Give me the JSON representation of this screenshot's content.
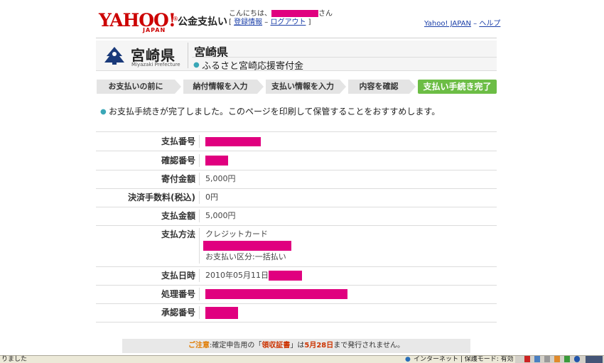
{
  "header": {
    "logo_text": "YAHOO!",
    "logo_sub": "JAPAN",
    "logo_mark": "®",
    "service_title": "公金支払い",
    "greeting_prefix": "こんにちは、",
    "greeting_suffix": "さん",
    "link_register": "登録情報",
    "link_logout": "ログアウト",
    "bracket_open": "[",
    "bracket_close": "]",
    "sep": "–",
    "top_link_yahoo": "Yahoo! JAPAN",
    "top_link_help": "ヘルプ"
  },
  "prefecture": {
    "name": "宮崎県",
    "name_en": "Miyazaki Prefecture",
    "title": "宮崎県",
    "subtitle": "ふるさと宮崎応援寄付金"
  },
  "steps": [
    {
      "label": "お支払いの前に",
      "active": false
    },
    {
      "label": "納付情報を入力",
      "active": false
    },
    {
      "label": "支払い情報を入力",
      "active": false
    },
    {
      "label": "内容を確認",
      "active": false
    },
    {
      "label": "支払い手続き完了",
      "active": true
    }
  ],
  "message": "お支払手続きが完了しました。このページを印刷して保管することをおすすめします。",
  "details": [
    {
      "label": "支払番号",
      "value": ""
    },
    {
      "label": "確認番号",
      "value": ""
    },
    {
      "label": "寄付金額",
      "value": "5,000円"
    },
    {
      "label": "決済手数料(税込)",
      "value": "0円"
    },
    {
      "label": "支払金額",
      "value": "5,000円"
    },
    {
      "label": "支払方法",
      "value": "クレジットカード",
      "value2": "お支払い区分:一括払い"
    },
    {
      "label": "支払日時",
      "value": "2010年05月11日"
    },
    {
      "label": "処理番号",
      "value": ""
    },
    {
      "label": "承認番号",
      "value": ""
    }
  ],
  "notice": {
    "warn": "ご注意",
    "text1": ":確定申告用の「",
    "highlight1": "領収証書",
    "text2": "」は",
    "highlight2": "5月28日",
    "text3": "まで発行されません。"
  },
  "statusbar": {
    "left": "りました",
    "internet": "インターネット | 保護モード: 有効"
  },
  "colors": {
    "yahoo_red": "#cc0000",
    "active_step": "#6cbd45",
    "redaction": "#e0007f",
    "link": "#1a3ea8"
  }
}
